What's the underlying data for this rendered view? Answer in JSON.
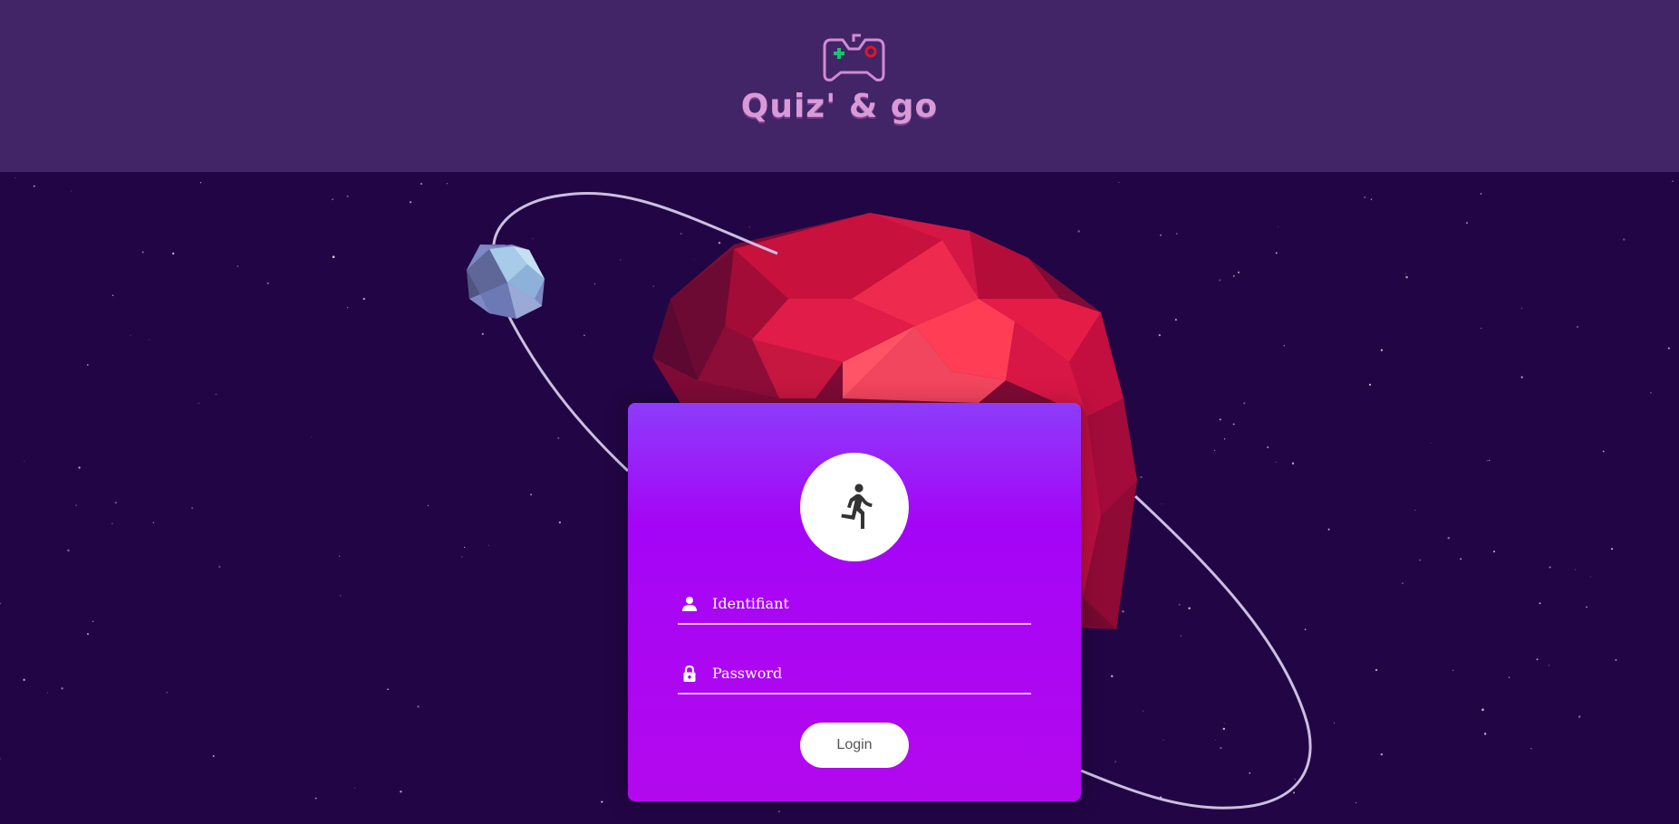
{
  "app": {
    "brand_name": "Quiz' & go",
    "logo_icon": "gamepad-icon"
  },
  "colors": {
    "background": "#220544",
    "header": "#422566",
    "brand_text": "#d99ad8",
    "logo_plus": "#19c36b",
    "logo_circle": "#e0162b",
    "planet": "#e0183c",
    "card_top": "#8d3cfb",
    "card_bottom": "#b308ee"
  },
  "login_form": {
    "avatar_icon": "running-person-icon",
    "username": {
      "icon": "user-icon",
      "placeholder": "Identifiant",
      "value": ""
    },
    "password": {
      "icon": "lock-icon",
      "placeholder": "Password",
      "value": ""
    },
    "submit_label": "Login"
  }
}
